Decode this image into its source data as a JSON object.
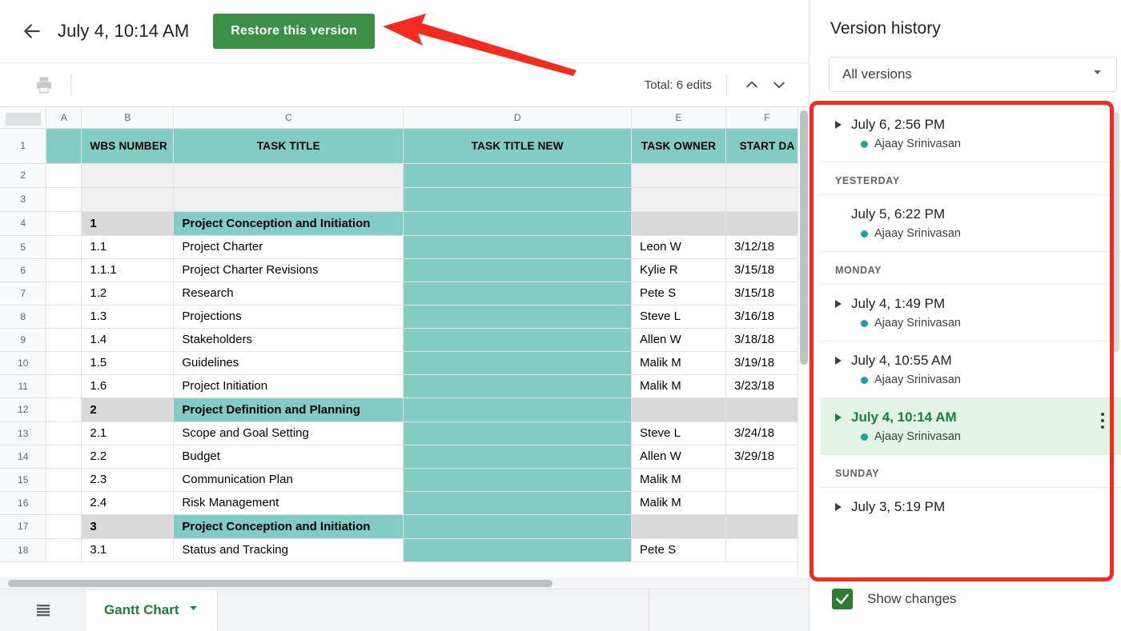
{
  "header": {
    "back_icon": "back-arrow-icon",
    "version_title": "July 4, 10:14 AM",
    "restore_label": "Restore this version"
  },
  "toolbar": {
    "print_icon": "print-icon",
    "edits_total": "Total: 6 edits",
    "nav_prev_icon": "chevron-up-icon",
    "nav_next_icon": "chevron-down-icon"
  },
  "sheet": {
    "column_letters": [
      "A",
      "B",
      "C",
      "D",
      "E",
      "F"
    ],
    "row_numbers": [
      "1",
      "2",
      "3",
      "4",
      "5",
      "6",
      "7",
      "8",
      "9",
      "10",
      "11",
      "12",
      "13",
      "14",
      "15",
      "16",
      "17",
      "18"
    ],
    "headers": {
      "b": "WBS NUMBER",
      "c": "TASK TITLE",
      "d": "TASK TITLE NEW",
      "e": "TASK OWNER",
      "f": "START DA"
    },
    "rows": [
      {
        "n": "2",
        "b": "",
        "c": "",
        "d": "",
        "e": "",
        "f": "",
        "style": "blank"
      },
      {
        "n": "3",
        "b": "",
        "c": "",
        "d": "",
        "e": "",
        "f": "",
        "style": "blank"
      },
      {
        "n": "4",
        "b": "1",
        "c": "Project Conception and Initiation",
        "d": "",
        "e": "",
        "f": "",
        "style": "section"
      },
      {
        "n": "5",
        "b": "1.1",
        "c": "Project Charter",
        "d": "",
        "e": "Leon W",
        "f": "3/12/18",
        "style": "task"
      },
      {
        "n": "6",
        "b": "1.1.1",
        "c": "Project Charter Revisions",
        "d": "",
        "e": "Kylie R",
        "f": "3/15/18",
        "style": "task"
      },
      {
        "n": "7",
        "b": "1.2",
        "c": "Research",
        "d": "",
        "e": "Pete S",
        "f": "3/15/18",
        "style": "task"
      },
      {
        "n": "8",
        "b": "1.3",
        "c": "Projections",
        "d": "",
        "e": "Steve L",
        "f": "3/16/18",
        "style": "task"
      },
      {
        "n": "9",
        "b": "1.4",
        "c": "Stakeholders",
        "d": "",
        "e": "Allen W",
        "f": "3/18/18",
        "style": "task"
      },
      {
        "n": "10",
        "b": "1.5",
        "c": "Guidelines",
        "d": "",
        "e": "Malik M",
        "f": "3/19/18",
        "style": "task"
      },
      {
        "n": "11",
        "b": "1.6",
        "c": "Project Initiation",
        "d": "",
        "e": "Malik M",
        "f": "3/23/18",
        "style": "task"
      },
      {
        "n": "12",
        "b": "2",
        "c": "Project Definition and Planning",
        "d": "",
        "e": "",
        "f": "",
        "style": "section"
      },
      {
        "n": "13",
        "b": "2.1",
        "c": "Scope and Goal Setting",
        "d": "",
        "e": "Steve L",
        "f": "3/24/18",
        "style": "task"
      },
      {
        "n": "14",
        "b": "2.2",
        "c": "Budget",
        "d": "",
        "e": "Allen W",
        "f": "3/29/18",
        "style": "task"
      },
      {
        "n": "15",
        "b": "2.3",
        "c": "Communication Plan",
        "d": "",
        "e": "Malik M",
        "f": "",
        "style": "task"
      },
      {
        "n": "16",
        "b": "2.4",
        "c": "Risk Management",
        "d": "",
        "e": "Malik M",
        "f": "",
        "style": "task"
      },
      {
        "n": "17",
        "b": "3",
        "c": "Project Conception and Initiation",
        "d": "",
        "e": "",
        "f": "",
        "style": "section"
      },
      {
        "n": "18",
        "b": "3.1",
        "c": "Status and Tracking",
        "d": "",
        "e": "Pete S",
        "f": "",
        "style": "task"
      }
    ],
    "colors": {
      "header_teal": "#82ccc5",
      "cell_teal": "#82ccc5",
      "section_gray": "#d9d9d9",
      "blank_gray": "#efefef"
    }
  },
  "sheetbar": {
    "all_sheets_icon": "all-sheets-icon",
    "tab_label": "Gantt Chart",
    "tab_caret_icon": "chevron-down-icon"
  },
  "panel": {
    "title": "Version history",
    "filter_value": "All versions",
    "filter_caret_icon": "chevron-down-icon",
    "versions": [
      {
        "type": "version",
        "time": "July 6, 2:56 PM",
        "author": "Ajaay Srinivasan",
        "expandable": true,
        "selected": false,
        "kebab": false
      },
      {
        "type": "day",
        "label": "YESTERDAY"
      },
      {
        "type": "version",
        "time": "July 5, 6:22 PM",
        "author": "Ajaay Srinivasan",
        "expandable": false,
        "selected": false,
        "kebab": false
      },
      {
        "type": "day",
        "label": "MONDAY"
      },
      {
        "type": "version",
        "time": "July 4, 1:49 PM",
        "author": "Ajaay Srinivasan",
        "expandable": true,
        "selected": false,
        "kebab": false
      },
      {
        "type": "version",
        "time": "July 4, 10:55 AM",
        "author": "Ajaay Srinivasan",
        "expandable": true,
        "selected": false,
        "kebab": false
      },
      {
        "type": "version",
        "time": "July 4, 10:14 AM",
        "author": "Ajaay Srinivasan",
        "expandable": true,
        "selected": true,
        "kebab": true
      },
      {
        "type": "day",
        "label": "SUNDAY"
      },
      {
        "type": "version",
        "time": "July 3, 5:19 PM",
        "author": "",
        "expandable": true,
        "selected": false,
        "kebab": false
      }
    ],
    "show_changes_label": "Show changes",
    "show_changes_checked": true
  },
  "annotations": {
    "arrow_color": "#f52b20",
    "rect_color": "#f52b20"
  }
}
